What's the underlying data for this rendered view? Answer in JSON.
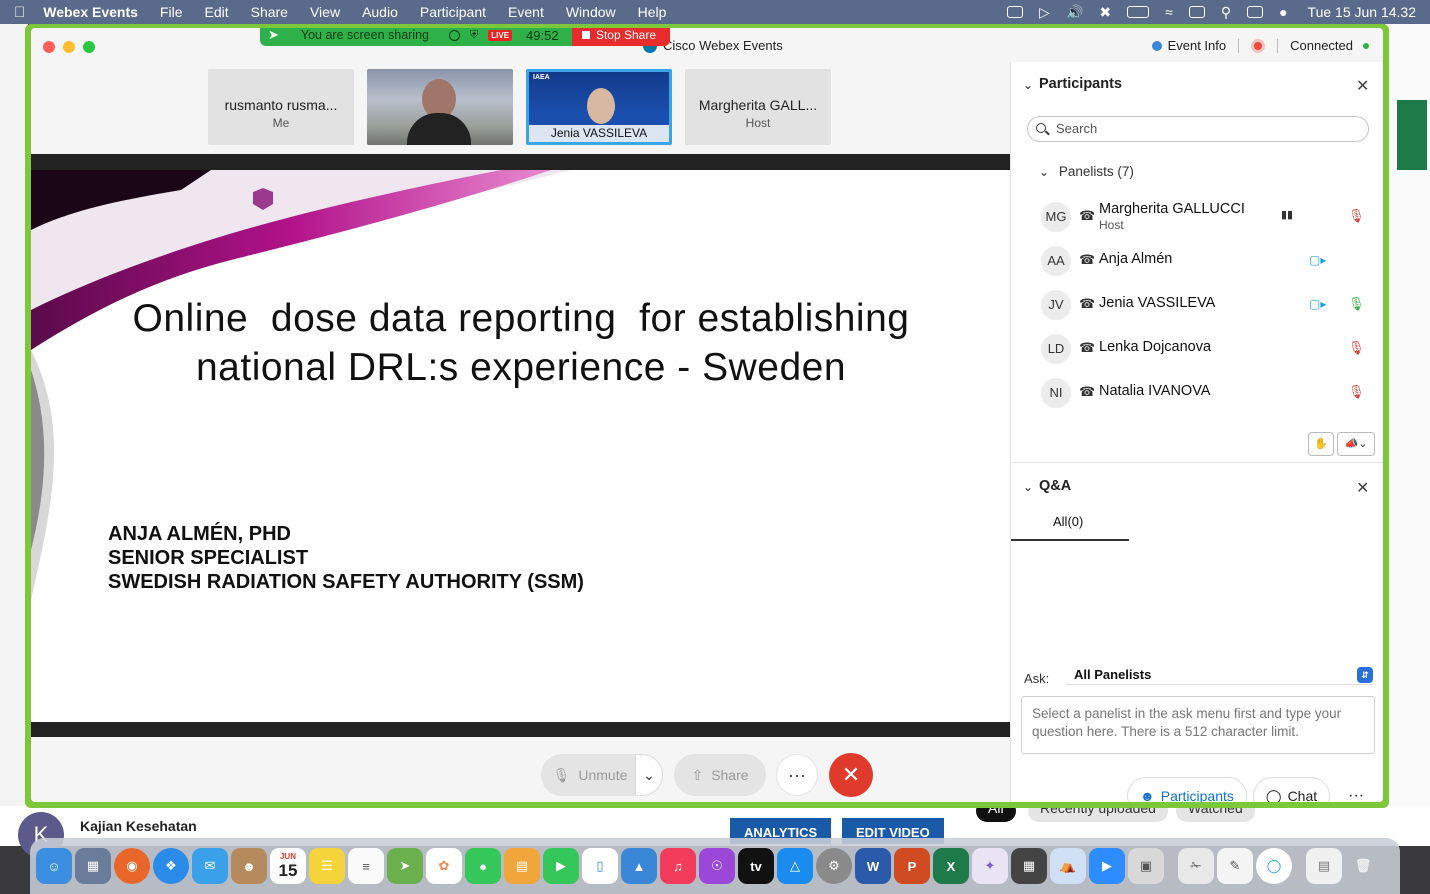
{
  "menubar": {
    "app_name": "Webex Events",
    "menus": [
      "File",
      "Edit",
      "Share",
      "View",
      "Audio",
      "Participant",
      "Event",
      "Window",
      "Help"
    ],
    "clock": "Tue 15 Jun  14.32"
  },
  "background": {
    "channel_initial": "K",
    "channel_name": "Kajian Kesehatan",
    "analytics_label": "ANALYTICS",
    "edit_video_label": "EDIT VIDEO",
    "chips": [
      "All",
      "Recently uploaded",
      "Watched"
    ]
  },
  "window": {
    "title": "Cisco Webex Events",
    "event_info": "Event Info",
    "status": "Connected",
    "share_banner": {
      "text": "You are screen sharing",
      "live": "LIVE",
      "timer": "49:52",
      "stop_label": "Stop Share"
    }
  },
  "thumbnails": [
    {
      "name": "rusmanto rusma...",
      "sub": "Me"
    },
    {
      "name": "",
      "sub": ""
    },
    {
      "name": "Jenia VASSILEVA",
      "sub": "",
      "badge": "IAEA"
    },
    {
      "name": "Margherita GALL...",
      "sub": "Host"
    }
  ],
  "slide": {
    "title_line1": "Online  dose data reporting  for establishing",
    "title_line2": "national DRL:s experience - Sweden",
    "author_line1": "ANJA ALMÉN, PHD",
    "author_line2": "SENIOR SPECIALIST",
    "author_line3": "SWEDISH RADIATION SAFETY AUTHORITY (SSM)"
  },
  "controls": {
    "unmute": "Unmute",
    "share": "Share",
    "more": "···",
    "leave": "✕"
  },
  "participants_panel": {
    "title": "Participants",
    "search_placeholder": "Search",
    "panelists_header": "Panelists (7)",
    "panelists": [
      {
        "initials": "MG",
        "name": "Margherita GALLUCCI",
        "role": "Host",
        "video": false,
        "mic": "muted"
      },
      {
        "initials": "AA",
        "name": "Anja Almén",
        "role": "",
        "video": true,
        "mic": "none"
      },
      {
        "initials": "JV",
        "name": "Jenia VASSILEVA",
        "role": "",
        "video": true,
        "mic": "active"
      },
      {
        "initials": "LD",
        "name": "Lenka Dojcanova",
        "role": "",
        "video": false,
        "mic": "muted"
      },
      {
        "initials": "NI",
        "name": "Natalia IVANOVA",
        "role": "",
        "video": false,
        "mic": "muted"
      }
    ]
  },
  "qa_panel": {
    "title": "Q&A",
    "tab_all": "All(0)",
    "ask_label": "Ask:",
    "ask_value": "All Panelists",
    "ask_placeholder": "Select a panelist in the ask menu first and type your question here. There is a 512 character limit."
  },
  "footer": {
    "participants": "Participants",
    "chat": "Chat",
    "more": "···"
  },
  "colors": {
    "window_border": "#7cc83a",
    "share_banner": "#2fb14a",
    "stop_share": "#e82b2b",
    "leave": "#e03a2c",
    "accent_blue": "#1170cf",
    "slide_magenta": "#b2128a"
  },
  "dock": {
    "calendar_month": "JUN",
    "calendar_day": "15",
    "tv_label": "tv"
  }
}
